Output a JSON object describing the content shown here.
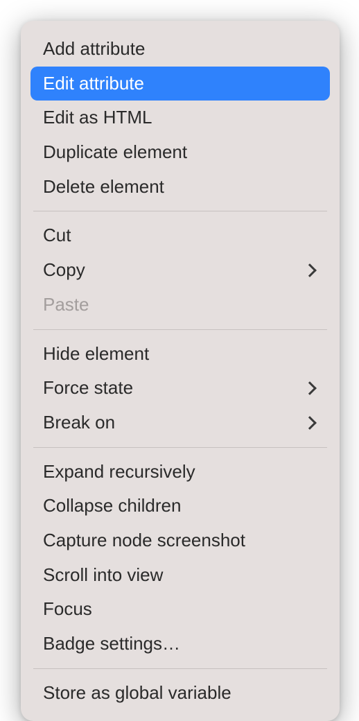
{
  "menu": {
    "add_attribute": "Add attribute",
    "edit_attribute": "Edit attribute",
    "edit_as_html": "Edit as HTML",
    "duplicate_element": "Duplicate element",
    "delete_element": "Delete element",
    "cut": "Cut",
    "copy": "Copy",
    "paste": "Paste",
    "hide_element": "Hide element",
    "force_state": "Force state",
    "break_on": "Break on",
    "expand_recursively": "Expand recursively",
    "collapse_children": "Collapse children",
    "capture_node_screenshot": "Capture node screenshot",
    "scroll_into_view": "Scroll into view",
    "focus": "Focus",
    "badge_settings": "Badge settings…",
    "store_as_global_variable": "Store as global variable"
  }
}
